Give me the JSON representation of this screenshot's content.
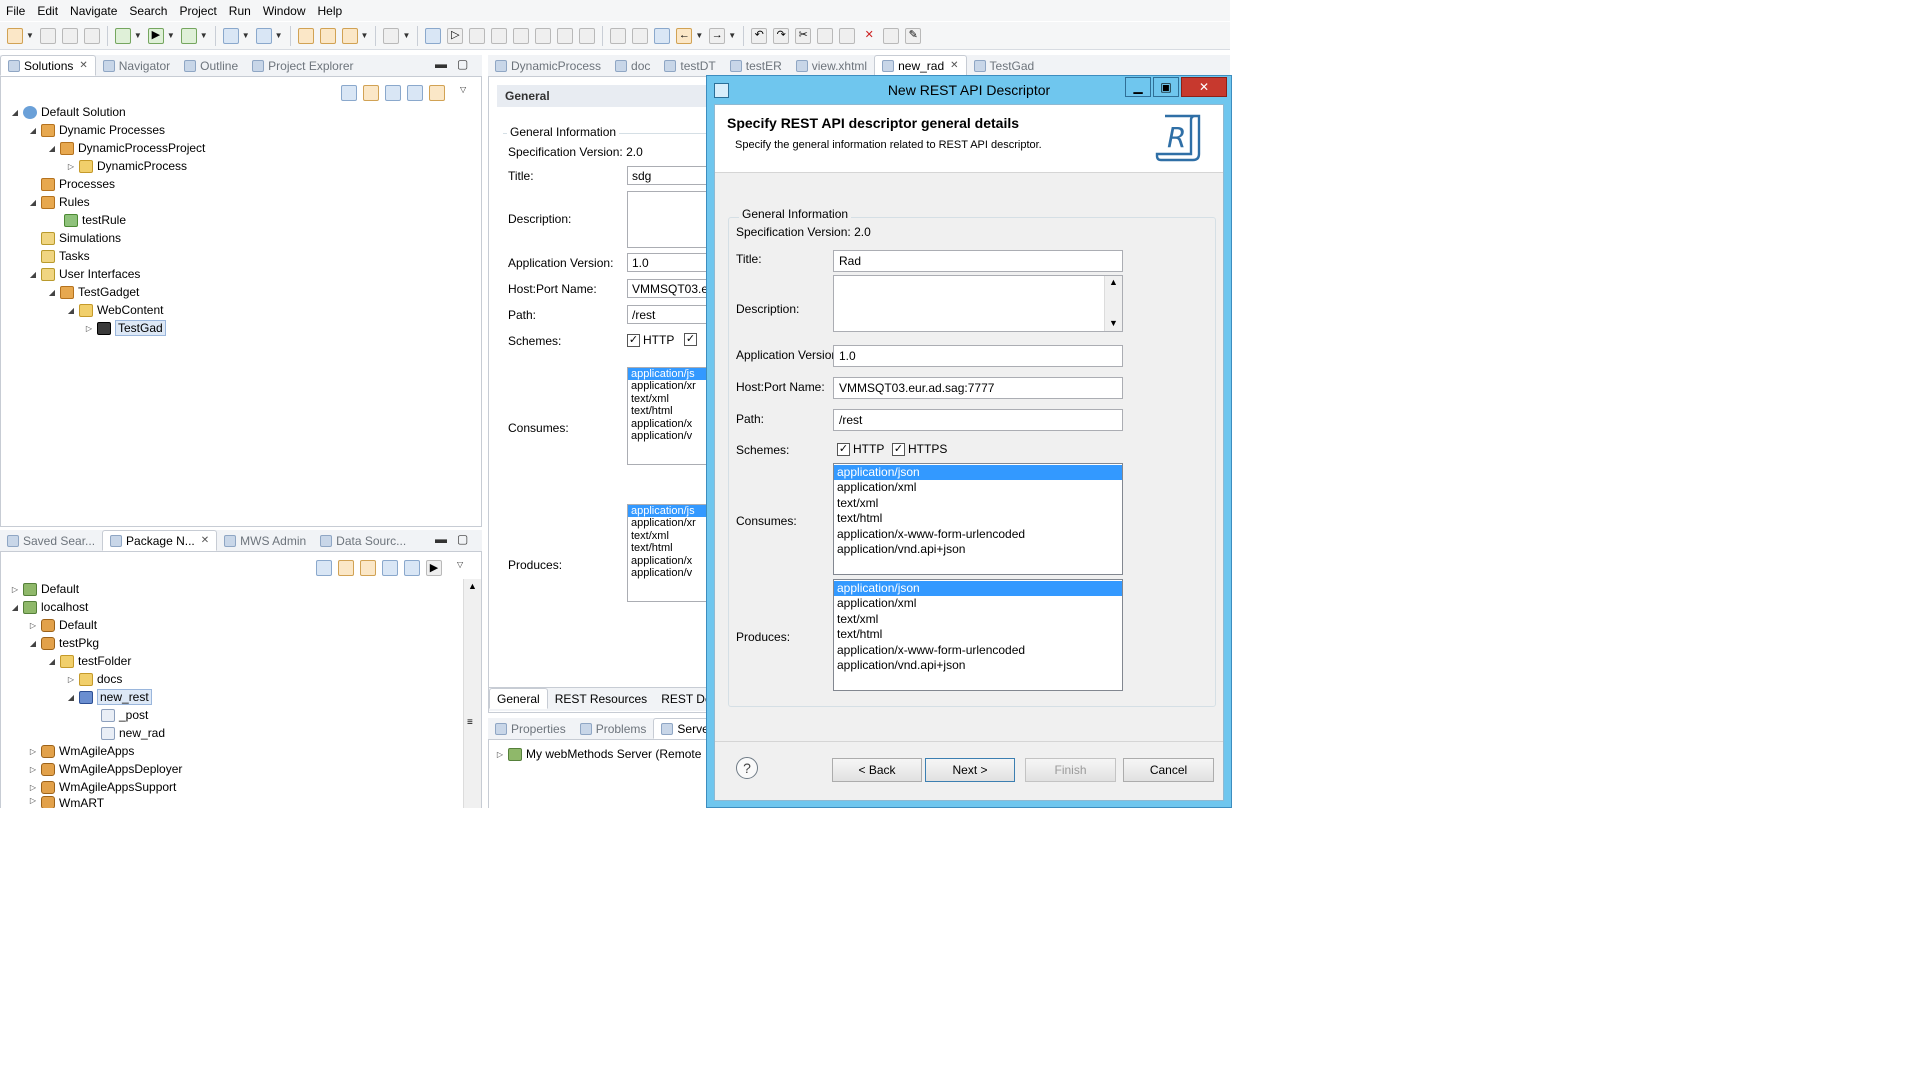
{
  "menubar": [
    "File",
    "Edit",
    "Navigate",
    "Search",
    "Project",
    "Run",
    "Window",
    "Help"
  ],
  "left_top_tabs": {
    "solutions": "Solutions",
    "navigator": "Navigator",
    "outline": "Outline",
    "project_explorer": "Project Explorer"
  },
  "solutions_tree": [
    "Default Solution",
    "Dynamic Processes",
    "DynamicProcessProject",
    "DynamicProcess",
    "Processes",
    "Rules",
    "testRule",
    "Simulations",
    "Tasks",
    "User Interfaces",
    "TestGadget",
    "WebContent",
    "TestGad"
  ],
  "left_bottom_tabs": {
    "saved_search": "Saved Sear...",
    "package_navigator": "Package N...",
    "mws_admin": "MWS Admin",
    "data_source": "Data Sourc..."
  },
  "package_tree": [
    "Default",
    "localhost",
    "Default",
    "testPkg",
    "testFolder",
    "docs",
    "new_rest",
    "_post",
    "new_rad",
    "WmAgileApps",
    "WmAgileAppsDeployer",
    "WmAgileAppsSupport",
    "WmART"
  ],
  "editor_tabs": [
    "DynamicProcess",
    "doc",
    "testDT",
    "testER",
    "view.xhtml",
    "new_rad",
    "TestGad"
  ],
  "editor": {
    "section": "General",
    "group": "General Information",
    "spec_version": "Specification Version: 2.0",
    "labels": {
      "title": "Title:",
      "description": "Description:",
      "app_version": "Application Version:",
      "host": "Host:Port Name:",
      "path": "Path:",
      "schemes": "Schemes:",
      "consumes": "Consumes:",
      "produces": "Produces:"
    },
    "title_value": "sdg",
    "app_version_value": "1.0",
    "host_value": "VMMSQT03.e",
    "path_value": "/rest",
    "scheme_http": "HTTP",
    "consumes": [
      "application/js",
      "application/xr",
      "text/xml",
      "text/html",
      "application/x",
      "application/v"
    ],
    "produces": [
      "application/js",
      "application/xr",
      "text/xml",
      "text/html",
      "application/x",
      "application/v"
    ],
    "bottom_tabs": [
      "General",
      "REST Resources",
      "REST Definiti"
    ]
  },
  "bottom_panel": {
    "tabs": [
      "Properties",
      "Problems",
      "Serve"
    ],
    "row": "My webMethods Server (Remote"
  },
  "dialog": {
    "window_title": "New REST API Descriptor",
    "header_title": "Specify REST API descriptor general details",
    "header_desc": "Specify the general information related to REST API descriptor.",
    "logo_letter": "R",
    "group_title": "General Information",
    "spec_version": "Specification Version:  2.0",
    "labels": {
      "title": "Title:",
      "description": "Description:",
      "app_version": "Application Version:",
      "host": "Host:Port Name:",
      "path": "Path:",
      "schemes": "Schemes:",
      "consumes": "Consumes:",
      "produces": "Produces:"
    },
    "values": {
      "title": "Rad",
      "description": "",
      "app_version": "1.0",
      "host": "VMMSQT03.eur.ad.sag:7777",
      "path": "/rest"
    },
    "schemes": {
      "http": "HTTP",
      "https": "HTTPS"
    },
    "consumes": [
      "application/json",
      "application/xml",
      "text/xml",
      "text/html",
      "application/x-www-form-urlencoded",
      "application/vnd.api+json"
    ],
    "produces": [
      "application/json",
      "application/xml",
      "text/xml",
      "text/html",
      "application/x-www-form-urlencoded",
      "application/vnd.api+json"
    ],
    "buttons": {
      "back": "< Back",
      "next": "Next >",
      "finish": "Finish",
      "cancel": "Cancel"
    },
    "help_glyph": "?"
  }
}
